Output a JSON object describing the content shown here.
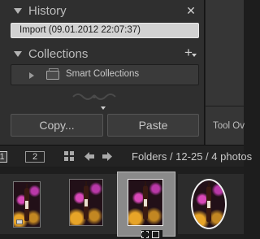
{
  "history": {
    "title": "History",
    "items": [
      "Import (09.01.2012 22:07:37)"
    ]
  },
  "collections": {
    "title": "Collections",
    "items": [
      {
        "label": "Smart Collections"
      }
    ]
  },
  "buttons": {
    "copy": "Copy...",
    "paste": "Paste"
  },
  "toolbar": {
    "tool_overlay": "Tool Ov",
    "page1": "1",
    "page2": "2",
    "folder_path": "Folders / 12-25 / 4 photos"
  },
  "colors": {
    "panel": "#2f2f2f",
    "selected_history": "#d2d2d2",
    "filmstrip": "#1e1e1e",
    "selected_cell": "#8a8a8a"
  },
  "icons": [
    "disclosure-triangle-icon",
    "close-icon",
    "plus-icon",
    "smart-collection-icon",
    "grid-view-icon",
    "back-arrow-icon",
    "forward-arrow-icon",
    "crop-icon"
  ]
}
